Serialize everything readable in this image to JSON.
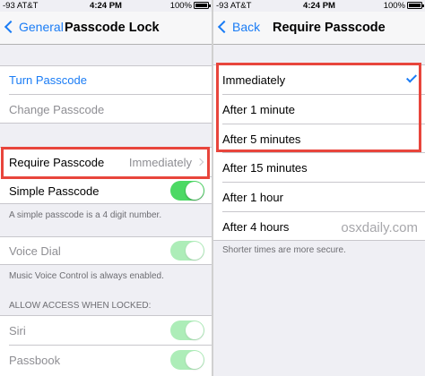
{
  "left": {
    "status": {
      "carrier": "-93 AT&T",
      "time": "4:24 PM",
      "battery": "100%"
    },
    "nav": {
      "back_label": "General",
      "title": "Passcode Lock"
    },
    "turn_passcode": "Turn Passcode",
    "change_passcode": "Change Passcode",
    "require_passcode": {
      "label": "Require Passcode",
      "value": "Immediately"
    },
    "simple_passcode": {
      "label": "Simple Passcode",
      "on": true
    },
    "simple_note": "A simple passcode is a 4 digit number.",
    "voice_dial": {
      "label": "Voice Dial",
      "on": true
    },
    "voice_note": "Music Voice Control is always enabled.",
    "locked_header": "ALLOW ACCESS WHEN LOCKED:",
    "siri": {
      "label": "Siri",
      "on": true
    },
    "passbook": {
      "label": "Passbook",
      "on": true
    }
  },
  "right": {
    "status": {
      "carrier": "-93 AT&T",
      "time": "4:24 PM",
      "battery": "100%"
    },
    "nav": {
      "back_label": "Back",
      "title": "Require Passcode"
    },
    "options": [
      "Immediately",
      "After 1 minute",
      "After 5 minutes",
      "After 15 minutes",
      "After 1 hour",
      "After 4 hours"
    ],
    "selected_option": "Immediately",
    "footer": "Shorter times are more secure.",
    "watermark": "osxdaily.com"
  },
  "colors": {
    "accent": "#1a7cf5",
    "toggle_on": "#4cd964",
    "highlight": "#e8453c"
  }
}
